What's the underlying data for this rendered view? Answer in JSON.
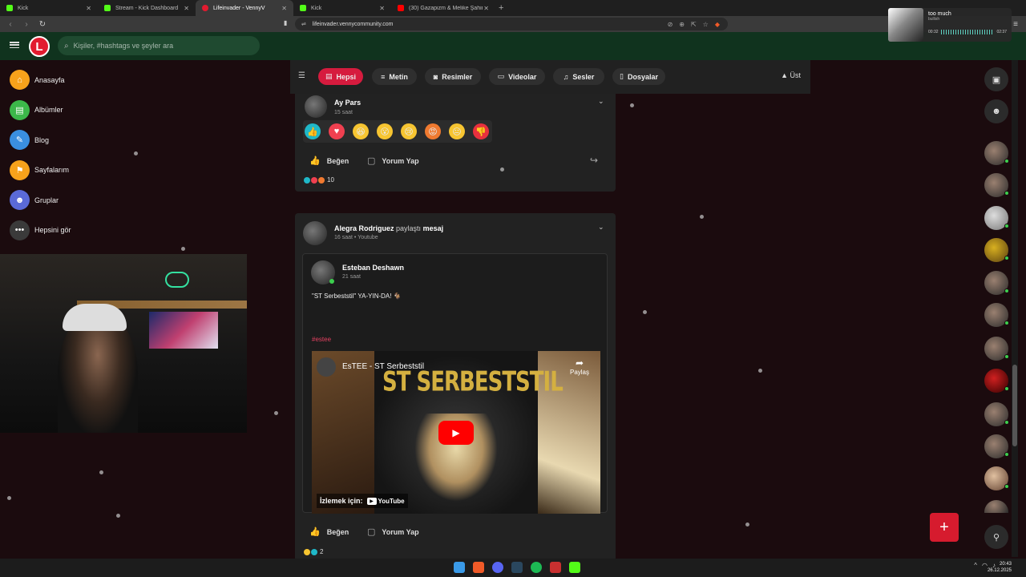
{
  "browser": {
    "tabs": [
      {
        "title": "Kick",
        "favicon_color": "#53fc18",
        "active": false
      },
      {
        "title": "Stream - Kick Dashboard",
        "favicon_color": "#53fc18",
        "active": false
      },
      {
        "title": "Lifeinvader - VennyV",
        "favicon_color": "#e21b2f",
        "active": true
      },
      {
        "title": "Kick",
        "favicon_color": "#53fc18",
        "active": false
      },
      {
        "title": "(30) Gazapizm & Melike Şahin - Olur",
        "favicon_color": "#ff0000",
        "active": false
      }
    ],
    "url": "lifeinvader.vennycommunity.com"
  },
  "header": {
    "logo_letter": "L",
    "search_placeholder": "Kişiler, #hashtags ve şeyler ara"
  },
  "music": {
    "song": "too much",
    "artist": "bullish",
    "elapsed": "00:32",
    "duration": "02:37",
    "progress": 0.2
  },
  "sidebar": {
    "items": [
      {
        "label": "Anasayfa",
        "icon": "home-icon",
        "color": "#f7a21b"
      },
      {
        "label": "Albümler",
        "icon": "album-icon",
        "color": "#3cb84a"
      },
      {
        "label": "Blog",
        "icon": "blog-icon",
        "color": "#3a8fe0"
      },
      {
        "label": "Sayfalarım",
        "icon": "flag-icon",
        "color": "#f7a21b"
      },
      {
        "label": "Gruplar",
        "icon": "group-icon",
        "color": "#5a6ad8"
      },
      {
        "label": "Hepsini gör",
        "icon": "more-icon",
        "color": "#3a3a3a"
      }
    ]
  },
  "filters": {
    "chips": [
      {
        "label": "Hepsi",
        "icon": "all-icon",
        "active": true
      },
      {
        "label": "Metin",
        "icon": "text-icon",
        "active": false
      },
      {
        "label": "Resimler",
        "icon": "camera-icon",
        "active": false
      },
      {
        "label": "Videolar",
        "icon": "video-icon",
        "active": false
      },
      {
        "label": "Sesler",
        "icon": "music-icon",
        "active": false
      },
      {
        "label": "Dosyalar",
        "icon": "file-icon",
        "active": false
      }
    ],
    "top_label": "Üst"
  },
  "post1": {
    "author": "Ay Pars",
    "time": "15 saat",
    "like_label": "Beğen",
    "comment_label": "Yorum Yap",
    "reaction_count": "10",
    "reactions": [
      "like",
      "love",
      "haha",
      "wow",
      "sad",
      "angry",
      "meh",
      "dislike"
    ]
  },
  "post2": {
    "author": "Alegra Rodriguez",
    "shared": "paylaştı",
    "shared_object": "mesaj",
    "time": "16 saat",
    "source": "Youtube",
    "inner": {
      "author": "Esteban Deshawn",
      "time": "21 saat",
      "text": "\"ST Serbeststil\" YA-YIN-DA! 🐐",
      "hashtag": "#estee",
      "video": {
        "title": "EsTEE - ST Serbeststil",
        "art_text": "ST SERBESTSTIL",
        "share_label": "Paylaş",
        "watch_label": "İzlemek için:",
        "youtube_label": "YouTube"
      }
    },
    "like_label": "Beğen",
    "comment_label": "Yorum Yap",
    "reaction_count": "2"
  },
  "taskbar": {
    "time": "20:43",
    "date": "26.12.2025"
  },
  "colors": {
    "accent": "#d61b3e",
    "header_bg": "#10331e",
    "online": "#3ccf4e"
  }
}
